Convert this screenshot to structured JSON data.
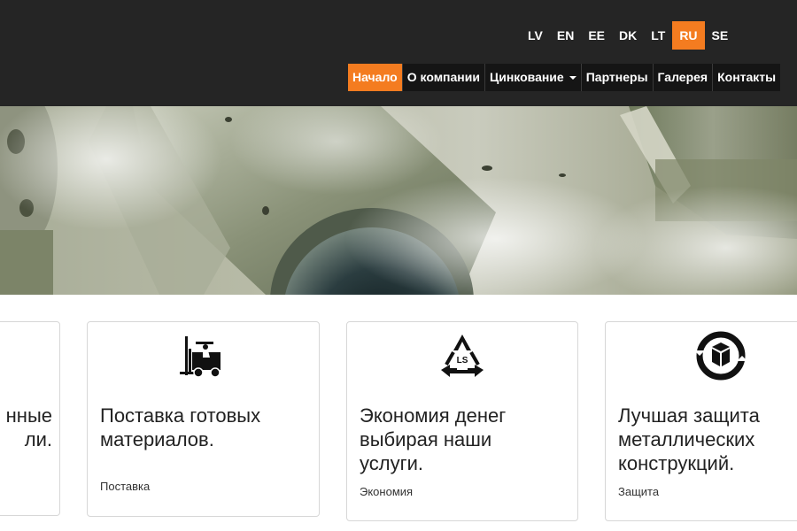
{
  "languages": [
    {
      "code": "LV",
      "active": false
    },
    {
      "code": "EN",
      "active": false
    },
    {
      "code": "EE",
      "active": false
    },
    {
      "code": "DK",
      "active": false
    },
    {
      "code": "LT",
      "active": false
    },
    {
      "code": "RU",
      "active": true
    },
    {
      "code": "SE",
      "active": false
    }
  ],
  "nav": {
    "items": [
      {
        "label": "Начало",
        "active": true
      },
      {
        "label": "О компании",
        "active": false
      },
      {
        "label": "Цинкование",
        "active": false,
        "dropdown": true
      },
      {
        "label": "Партнеры",
        "active": false
      },
      {
        "label": "Галерея",
        "active": false
      },
      {
        "label": "Контакты",
        "active": false
      }
    ]
  },
  "colors": {
    "accent": "#f47c20",
    "topbar": "#252525"
  },
  "cards": [
    {
      "title_line1": "нные",
      "title_line2": "ли.",
      "tag": ""
    },
    {
      "icon": "forklift-icon",
      "title_line1": "Поставка готовых",
      "title_line2": "материалов.",
      "tag": "Поставка"
    },
    {
      "icon": "recycle-ls-icon",
      "title_line1": "Экономия денег",
      "title_line2": "выбирая наши",
      "title_line3": "услуги.",
      "tag": "Экономия"
    },
    {
      "icon": "box-recycle-icon",
      "title_line1": "Лучшая защита",
      "title_line2": "металлических",
      "title_line3": "конструкций.",
      "tag": "Защита"
    }
  ]
}
